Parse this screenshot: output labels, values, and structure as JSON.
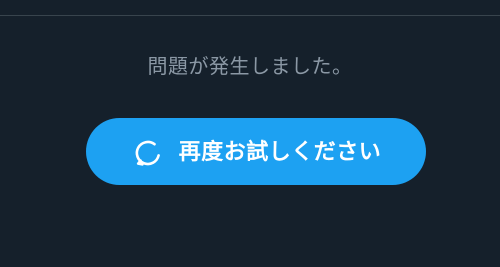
{
  "error": {
    "message": "問題が発生しました。",
    "retry_label": "再度お試しください",
    "retry_icon": "refresh-icon"
  },
  "colors": {
    "background": "#15202b",
    "accent": "#1da1f2",
    "message_text": "#8b98a5",
    "divider": "#38444d"
  }
}
